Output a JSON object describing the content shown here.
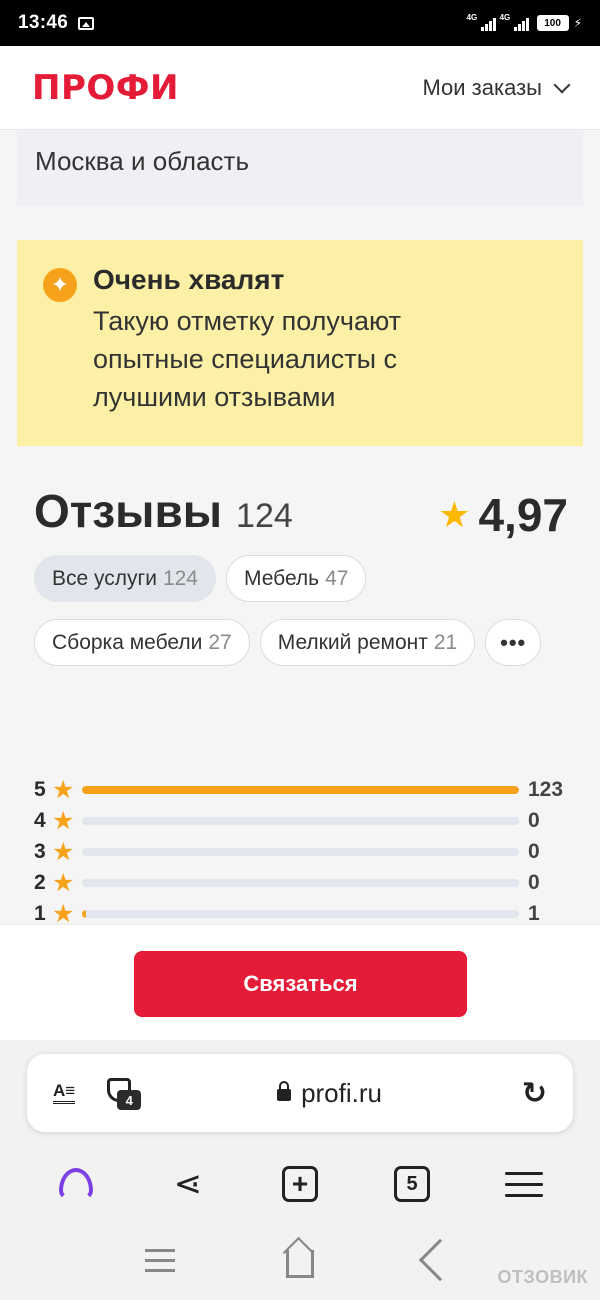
{
  "status_bar": {
    "time": "13:46",
    "network_1": "4G",
    "network_2": "4G",
    "battery": "100"
  },
  "header": {
    "logo": "ПРОФИ",
    "orders_label": "Мои заказы"
  },
  "region": {
    "text": "Москва и область"
  },
  "praise": {
    "title": "Очень хвалят",
    "description": "Такую отметку получают опытные специалисты с лучшими отзывами"
  },
  "reviews": {
    "title": "Отзывы",
    "count": "124",
    "rating": "4,97",
    "chips": [
      {
        "label": "Все услуги",
        "count": "124"
      },
      {
        "label": "Мебель",
        "count": "47"
      },
      {
        "label": "Сборка мебели",
        "count": "27"
      },
      {
        "label": "Мелкий ремонт",
        "count": "21"
      }
    ],
    "more_label": "•••",
    "distribution": [
      {
        "stars": "5",
        "count": "123",
        "fraction": 1.0
      },
      {
        "stars": "4",
        "count": "0",
        "fraction": 0
      },
      {
        "stars": "3",
        "count": "0",
        "fraction": 0
      },
      {
        "stars": "2",
        "count": "0",
        "fraction": 0
      },
      {
        "stars": "1",
        "count": "1",
        "fraction": 0.008
      }
    ]
  },
  "contact": {
    "button_label": "Связаться"
  },
  "browser": {
    "url": "profi.ru",
    "shield_badge": "4",
    "tabs_count": "5"
  },
  "watermark": "ОТЗОВИК",
  "colors": {
    "brand": "#e41c38",
    "accent": "#f7a21b",
    "praise_bg": "#fbf0a5",
    "alice": "#7b3fe4"
  }
}
